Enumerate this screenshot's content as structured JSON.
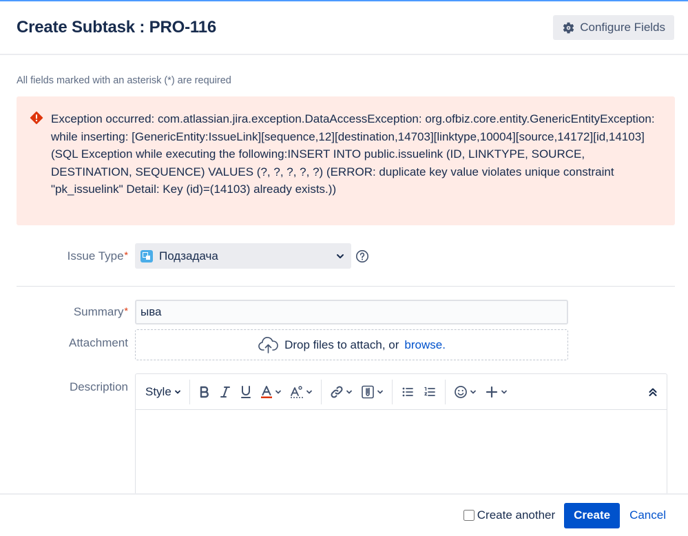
{
  "dialog": {
    "title": "Create Subtask : PRO-116",
    "configure_fields_label": "Configure Fields"
  },
  "required_note": "All fields marked with an asterisk (*) are required",
  "error": {
    "message": "Exception occurred: com.atlassian.jira.exception.DataAccessException: org.ofbiz.core.entity.GenericEntityException: while inserting: [GenericEntity:IssueLink][sequence,12][destination,14703][linktype,10004][source,14172][id,14103] (SQL Exception while executing the following:INSERT INTO public.issuelink (ID, LINKTYPE, SOURCE, DESTINATION, SEQUENCE) VALUES (?, ?, ?, ?, ?) (ERROR: duplicate key value violates unique constraint \"pk_issuelink\" Detail: Key (id)=(14103) already exists.))"
  },
  "fields": {
    "issue_type": {
      "label": "Issue Type",
      "required_mark": "*",
      "value": "Подзадача"
    },
    "summary": {
      "label": "Summary",
      "required_mark": "*",
      "value": "ыва"
    },
    "attachment": {
      "label": "Attachment",
      "drop_text": "Drop files to attach, or",
      "browse_text": "browse."
    },
    "description": {
      "label": "Description",
      "style_label": "Style"
    }
  },
  "footer": {
    "create_another_label": "Create another",
    "create_label": "Create",
    "cancel_label": "Cancel"
  },
  "colors": {
    "primary": "#0052cc",
    "error_bg": "#ffebe6",
    "error_icon": "#de350b",
    "text_subtle": "#5e6c84"
  }
}
